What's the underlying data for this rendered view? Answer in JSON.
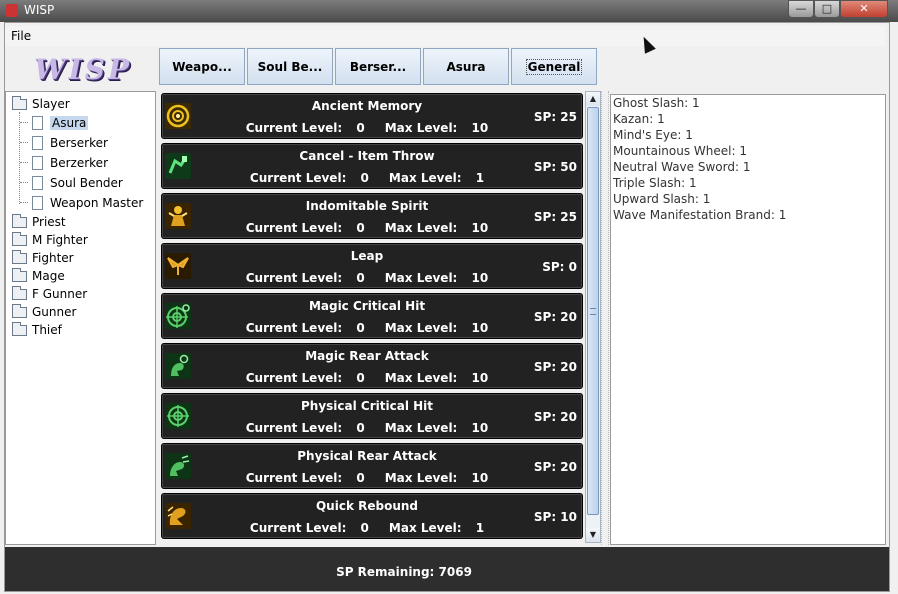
{
  "window": {
    "title": "WISP"
  },
  "menu": {
    "file": "File"
  },
  "logo": {
    "text": "WISP"
  },
  "tabs": [
    {
      "label": "Weapo..."
    },
    {
      "label": "Soul Be..."
    },
    {
      "label": "Berser..."
    },
    {
      "label": "Asura"
    },
    {
      "label": "General"
    }
  ],
  "tree": {
    "root": "Slayer",
    "children": [
      "Asura",
      "Berserker",
      "Berzerker",
      "Soul Bender",
      "Weapon Master"
    ],
    "classes": [
      "Priest",
      "M Fighter",
      "Fighter",
      "Mage",
      "F Gunner",
      "Gunner",
      "Thief"
    ]
  },
  "level_labels": {
    "current": "Current Level: ",
    "max": "Max Level: "
  },
  "skills": [
    {
      "name": "Ancient Memory",
      "current": "0",
      "max": "10",
      "sp": "SP: 25",
      "icon": "eye-icon",
      "color": "#d9a21b"
    },
    {
      "name": "Cancel - Item Throw",
      "current": "0",
      "max": "1",
      "sp": "SP: 50",
      "icon": "throw-icon",
      "color": "#2f9a4f"
    },
    {
      "name": "Indomitable Spirit",
      "current": "0",
      "max": "10",
      "sp": "SP: 25",
      "icon": "spirit-icon",
      "color": "#e0a020"
    },
    {
      "name": "Leap",
      "current": "0",
      "max": "10",
      "sp": "SP: 0",
      "icon": "wings-icon",
      "color": "#c8921a"
    },
    {
      "name": "Magic Critical Hit",
      "current": "0",
      "max": "10",
      "sp": "SP: 20",
      "icon": "crosshair-icon",
      "color": "#3aa84a"
    },
    {
      "name": "Magic Rear Attack",
      "current": "0",
      "max": "10",
      "sp": "SP: 20",
      "icon": "rear-attack-icon",
      "color": "#3aa84a"
    },
    {
      "name": "Physical Critical Hit",
      "current": "0",
      "max": "10",
      "sp": "SP: 20",
      "icon": "crosshair-icon",
      "color": "#3aa84a"
    },
    {
      "name": "Physical Rear Attack",
      "current": "0",
      "max": "10",
      "sp": "SP: 20",
      "icon": "rear-attack-icon",
      "color": "#3aa84a"
    },
    {
      "name": "Quick Rebound",
      "current": "0",
      "max": "1",
      "sp": "SP: 10",
      "icon": "rebound-icon",
      "color": "#d9a21b"
    }
  ],
  "summary": [
    "Ghost Slash: 1",
    "Kazan: 1",
    "Mind's Eye: 1",
    "Mountainous Wheel: 1",
    "Neutral Wave Sword: 1",
    "Triple Slash: 1",
    "Upward Slash: 1",
    "Wave Manifestation Brand: 1"
  ],
  "status": {
    "text": "SP Remaining: 7069"
  }
}
